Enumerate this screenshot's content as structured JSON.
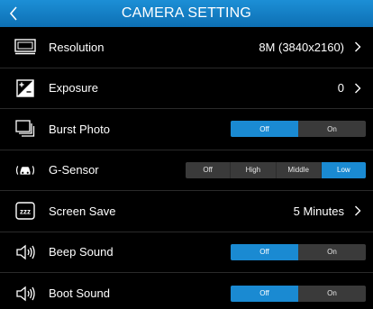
{
  "header": {
    "title": "CAMERA SETTING",
    "back_icon": "chevron-left-icon"
  },
  "colors": {
    "accent": "#1a8ad2",
    "header": "#1c8fd6",
    "background": "#000000"
  },
  "rows": {
    "resolution": {
      "label": "Resolution",
      "value": "8M (3840x2160)",
      "icon": "resolution-icon"
    },
    "exposure": {
      "label": "Exposure",
      "value": "0",
      "icon": "exposure-icon"
    },
    "burst": {
      "label": "Burst Photo",
      "options": [
        "Off",
        "On"
      ],
      "selected": "Off",
      "icon": "burst-photo-icon"
    },
    "gsensor": {
      "label": "G-Sensor",
      "options": [
        "Off",
        "High",
        "Middle",
        "Low"
      ],
      "selected": "Low",
      "icon": "car-sensor-icon"
    },
    "screensave": {
      "label": "Screen Save",
      "value": "5 Minutes",
      "icon": "zzz-icon"
    },
    "beep": {
      "label": "Beep Sound",
      "options": [
        "Off",
        "On"
      ],
      "selected": "Off",
      "icon": "speaker-icon"
    },
    "boot": {
      "label": "Boot Sound",
      "options": [
        "Off",
        "On"
      ],
      "selected": "Off",
      "icon": "speaker-icon"
    }
  }
}
